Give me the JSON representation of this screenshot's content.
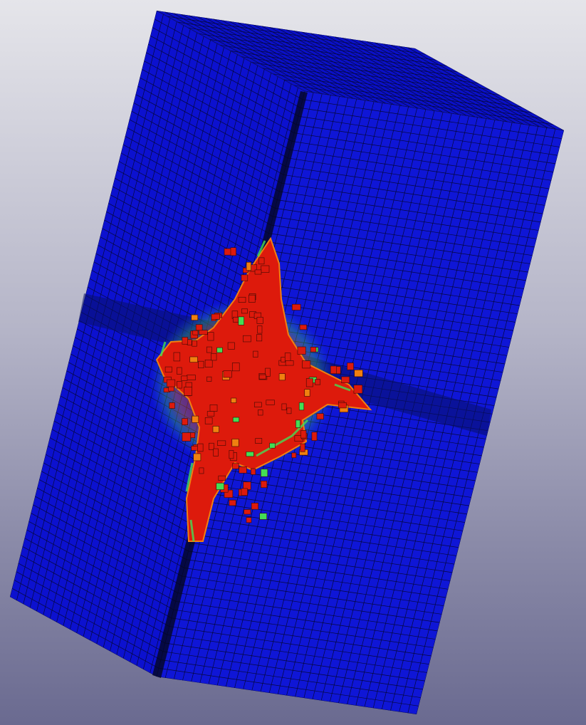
{
  "viewer": {
    "background": {
      "top": "#e5e5ea",
      "bottom": "#6a6a90"
    },
    "model": {
      "description_visible_text": "",
      "faces": [
        {
          "id": "face-left",
          "fill": "#0c11cf"
        },
        {
          "id": "face-right",
          "fill": "#0f16d6"
        },
        {
          "id": "face-top",
          "fill": "#0a10c8"
        }
      ],
      "mesh_color": "#06083a",
      "damage_colors": {
        "high": "#dd1a0c",
        "mid": "#f08010",
        "low": "#44dd55",
        "fringe": "#2080d8"
      }
    }
  }
}
